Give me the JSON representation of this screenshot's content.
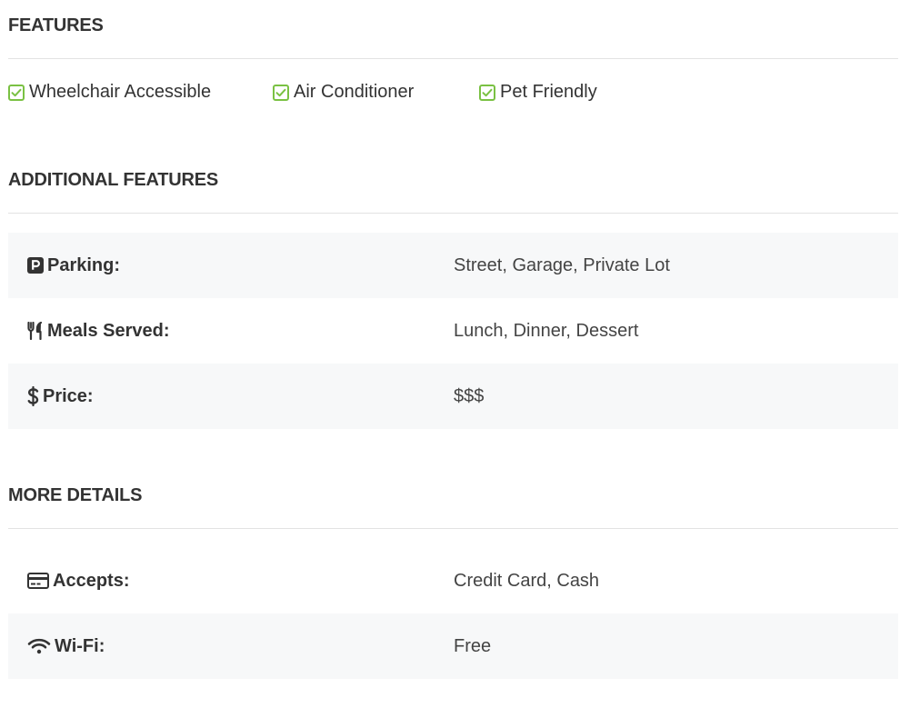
{
  "colors": {
    "check": "#7ac143",
    "text": "#333333",
    "shade": "#f7f8f9",
    "divider": "#e3e3e3"
  },
  "features": {
    "title": "FEATURES",
    "items": [
      {
        "label": "Wheelchair Accessible",
        "icon": "checkbox-checked-icon"
      },
      {
        "label": "Air Conditioner",
        "icon": "checkbox-checked-icon"
      },
      {
        "label": "Pet Friendly",
        "icon": "checkbox-checked-icon"
      }
    ]
  },
  "additional": {
    "title": "ADDITIONAL FEATURES",
    "rows": [
      {
        "icon": "parking-icon",
        "label": "Parking:",
        "value": "Street, Garage, Private Lot"
      },
      {
        "icon": "utensils-icon",
        "label": "Meals Served:",
        "value": "Lunch, Dinner, Dessert"
      },
      {
        "icon": "dollar-icon",
        "label": "Price:",
        "value": "$$$"
      }
    ]
  },
  "more": {
    "title": "MORE DETAILS",
    "rows": [
      {
        "icon": "credit-card-icon",
        "label": "Accepts:",
        "value": "Credit Card, Cash"
      },
      {
        "icon": "wifi-icon",
        "label": "Wi-Fi:",
        "value": "Free"
      }
    ]
  }
}
